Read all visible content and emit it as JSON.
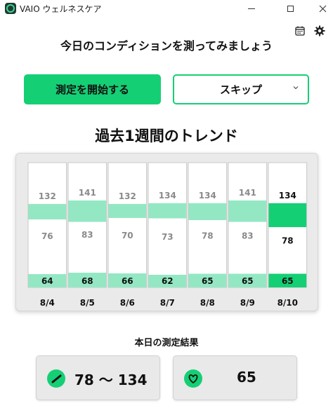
{
  "window": {
    "title": "VAIO ウェルネスケア"
  },
  "header": {
    "prompt": "今日のコンディションを測ってみましょう"
  },
  "actions": {
    "start_label": "測定を開始する",
    "skip_label": "スキップ"
  },
  "trend": {
    "title": "過去1週間のトレンド"
  },
  "chart_data": {
    "type": "table",
    "x": [
      "8/4",
      "8/5",
      "8/6",
      "8/7",
      "8/8",
      "8/9",
      "8/10"
    ],
    "series": [
      {
        "name": "",
        "values": [
          132,
          141,
          132,
          134,
          134,
          141,
          134
        ]
      },
      {
        "name": "",
        "values": [
          76,
          83,
          70,
          73,
          78,
          83,
          78
        ]
      },
      {
        "name": "",
        "values": [
          64,
          68,
          66,
          62,
          65,
          65,
          65
        ]
      }
    ],
    "highlight_index": 6,
    "colors": {
      "accent": "#15cf75",
      "light": "#93e8c3",
      "muted_text": "#8a8a8a"
    }
  },
  "result": {
    "title": "本日の測定結果",
    "bp_value": "78 〜 134",
    "hr_value": "65"
  },
  "icons": [
    "app-logo-icon",
    "minimize-icon",
    "maximize-icon",
    "close-icon",
    "calendar-icon",
    "gear-icon",
    "chevron-down-icon",
    "gauge-icon",
    "heart-icon"
  ]
}
